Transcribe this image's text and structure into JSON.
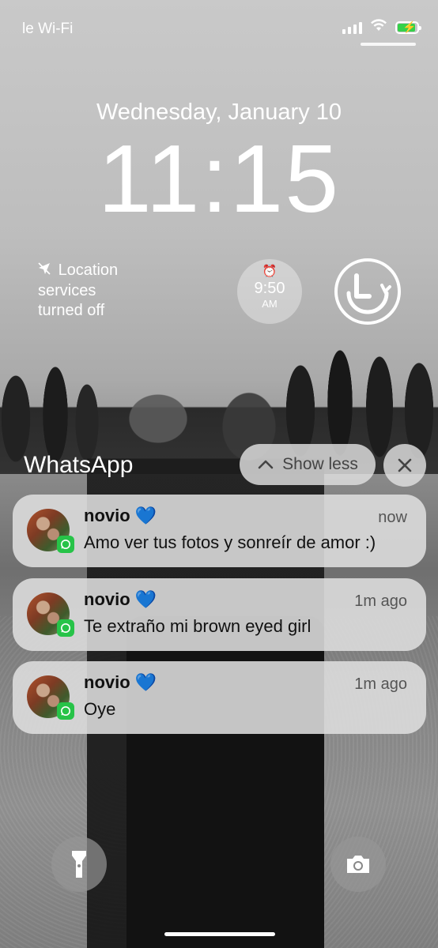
{
  "status_bar": {
    "carrier": "le Wi-Fi",
    "battery_color": "#35d14a"
  },
  "lock_screen": {
    "date": "Wednesday, January 10",
    "time": "11:15"
  },
  "widgets": {
    "location": {
      "icon": "location-off-icon",
      "line1": "Location",
      "line2": "services",
      "line3": "turned off"
    },
    "alarm": {
      "icon": "alarm-clock-icon",
      "time": "9:50",
      "period": "AM"
    },
    "app_widget": {
      "icon": "app-logo-icon"
    }
  },
  "notifications": {
    "app_name": "WhatsApp",
    "show_less_label": "Show less",
    "close_icon": "close-icon",
    "items": [
      {
        "sender": "novio",
        "emoji": "💙",
        "when": "now",
        "message": "Amo ver tus fotos y sonreír de amor :)"
      },
      {
        "sender": "novio",
        "emoji": "💙",
        "when": "1m ago",
        "message": "Te extraño mi brown eyed girl"
      },
      {
        "sender": "novio",
        "emoji": "💙",
        "when": "1m ago",
        "message": "Oye"
      }
    ],
    "badge_color": "#27c348",
    "heart_color": "#2f7bf5"
  },
  "quick_actions": {
    "left_icon": "flashlight-icon",
    "right_icon": "camera-icon"
  }
}
